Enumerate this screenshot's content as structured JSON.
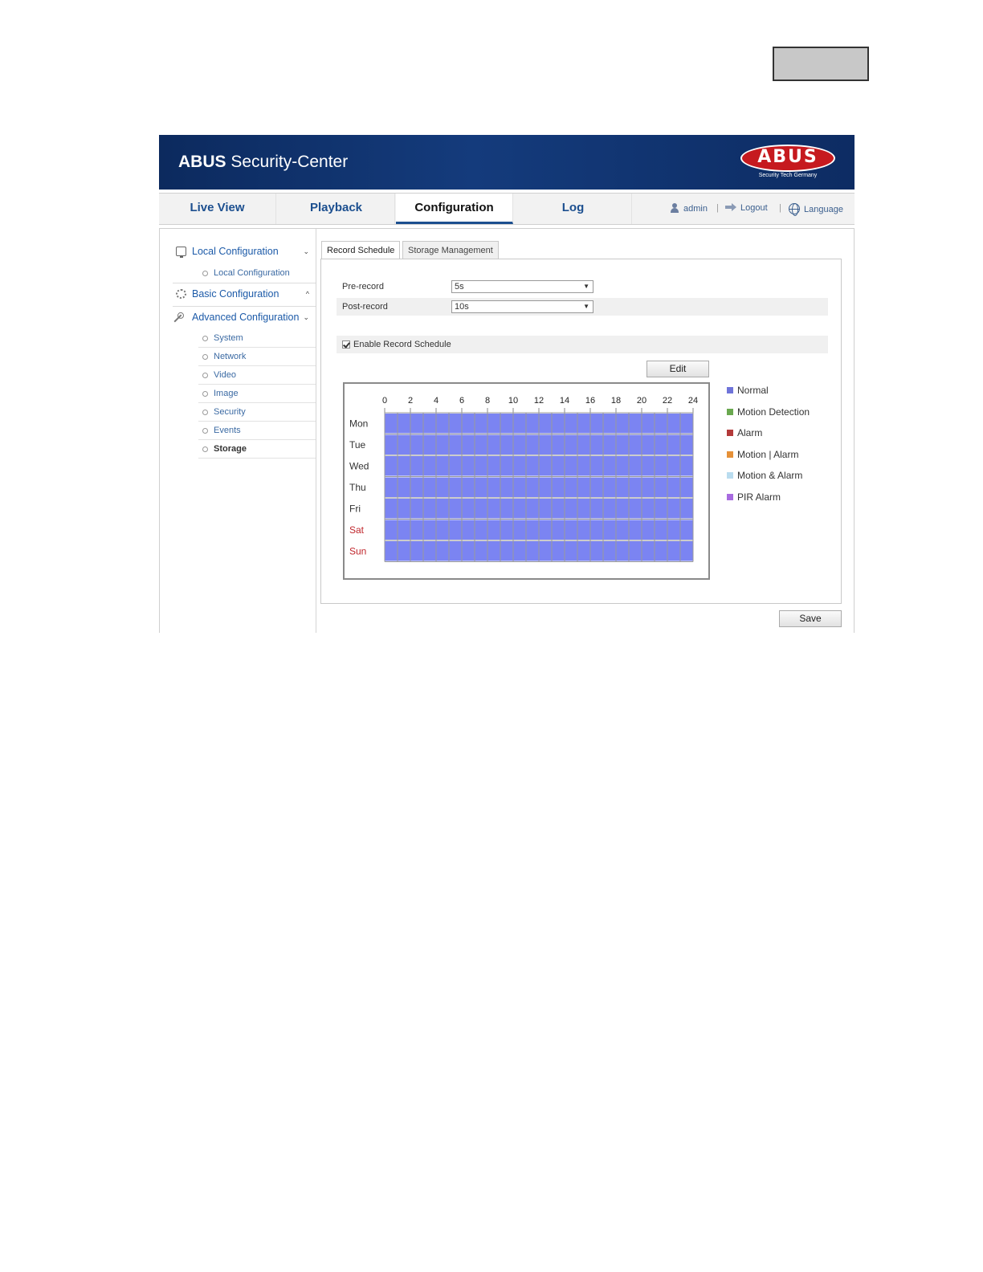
{
  "app": {
    "brand_bold": "ABUS",
    "brand_rest": " Security-Center",
    "logo_word": "ABUS",
    "logo_tagline": "Security Tech Germany"
  },
  "nav": {
    "tabs": [
      {
        "label": "Live View",
        "active": false
      },
      {
        "label": "Playback",
        "active": false
      },
      {
        "label": "Configuration",
        "active": true
      },
      {
        "label": "Log",
        "active": false
      }
    ],
    "user": "admin",
    "logout": "Logout",
    "language": "Language",
    "separator": "|"
  },
  "sidebar": {
    "local_config": {
      "label": "Local Configuration",
      "chevron": "⌄"
    },
    "local_items": [
      "Local Configuration"
    ],
    "basic_config": {
      "label": "Basic Configuration",
      "chevron": "^"
    },
    "advanced_config": {
      "label": "Advanced Configuration",
      "chevron": "⌄"
    },
    "advanced_items": [
      "System",
      "Network",
      "Video",
      "Image",
      "Security",
      "Events",
      "Storage"
    ],
    "active_item": "Storage"
  },
  "tabs": [
    {
      "label": "Record Schedule",
      "active": true
    },
    {
      "label": "Storage Management",
      "active": false
    }
  ],
  "form": {
    "pre_record": {
      "label": "Pre-record",
      "value": "5s"
    },
    "post_record": {
      "label": "Post-record",
      "value": "10s"
    },
    "enable_schedule": {
      "label": "Enable Record Schedule",
      "checked": true
    }
  },
  "buttons": {
    "edit": "Edit",
    "save": "Save"
  },
  "schedule": {
    "hour_labels": [
      "0",
      "2",
      "4",
      "6",
      "8",
      "10",
      "12",
      "14",
      "16",
      "18",
      "20",
      "22",
      "24"
    ],
    "days": [
      {
        "label": "Mon",
        "weekend": false
      },
      {
        "label": "Tue",
        "weekend": false
      },
      {
        "label": "Wed",
        "weekend": false
      },
      {
        "label": "Thu",
        "weekend": false
      },
      {
        "label": "Fri",
        "weekend": false
      },
      {
        "label": "Sat",
        "weekend": true
      },
      {
        "label": "Sun",
        "weekend": true
      }
    ],
    "hours_per_day": 24,
    "recording_type_all_days": "Normal",
    "colors": {
      "fill": "#7b84f2",
      "grid": "#9a9a9a",
      "weekend_text": "#c0272d"
    }
  },
  "legend": [
    {
      "label": "Normal",
      "color": "#6f74d9"
    },
    {
      "label": "Motion Detection",
      "color": "#6aa84f"
    },
    {
      "label": "Alarm",
      "color": "#b33a3a"
    },
    {
      "label": "Motion | Alarm",
      "color": "#e69138"
    },
    {
      "label": "Motion & Alarm",
      "color": "#b9dcef"
    },
    {
      "label": "PIR Alarm",
      "color": "#a86be0"
    }
  ],
  "colors": {
    "header_bg": "#0f2f68",
    "accent": "#1c4f8f",
    "link": "#3b6aa3"
  }
}
